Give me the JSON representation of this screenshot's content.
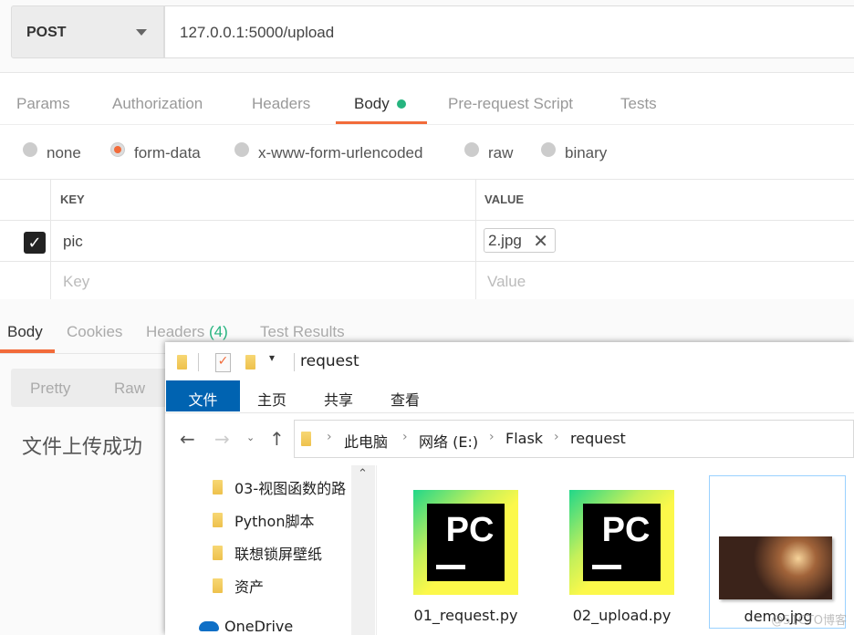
{
  "request": {
    "method": "POST",
    "url": "127.0.0.1:5000/upload"
  },
  "request_tabs": [
    {
      "label": "Params"
    },
    {
      "label": "Authorization"
    },
    {
      "label": "Headers"
    },
    {
      "label": "Body",
      "active": true
    },
    {
      "label": "Pre-request Script"
    },
    {
      "label": "Tests"
    }
  ],
  "body_types": [
    {
      "label": "none"
    },
    {
      "label": "form-data",
      "selected": true
    },
    {
      "label": "x-www-form-urlencoded"
    },
    {
      "label": "raw"
    },
    {
      "label": "binary"
    }
  ],
  "form_table": {
    "headers": [
      "KEY",
      "VALUE"
    ],
    "rows": [
      {
        "checked": true,
        "key": "pic",
        "value": "2.jpg"
      }
    ],
    "placeholders": {
      "key": "Key",
      "value": "Value"
    }
  },
  "response": {
    "tabs": [
      {
        "label": "Body",
        "active": true
      },
      {
        "label": "Cookies"
      },
      {
        "label": "Headers",
        "count": "(4)"
      },
      {
        "label": "Test Results"
      }
    ],
    "views": [
      "Pretty",
      "Raw"
    ],
    "body_text": "文件上传成功"
  },
  "explorer": {
    "title": "request",
    "ribbon_tabs": [
      "文件",
      "主页",
      "共享",
      "查看"
    ],
    "breadcrumb": [
      "此电脑",
      "网络 (E:)",
      "Flask",
      "request"
    ],
    "nav_items": [
      "03-视图函数的路",
      "Python脚本",
      "联想锁屏壁纸",
      "资产",
      "OneDrive"
    ],
    "files": [
      {
        "name": "01_request.py",
        "icon": "pycharm-icon"
      },
      {
        "name": "02_upload.py",
        "icon": "pycharm-icon"
      },
      {
        "name": "demo.jpg",
        "icon": "image-thumbnail",
        "selected": true
      }
    ]
  },
  "watermark": "@51CTO博客",
  "colors": {
    "accent": "#f26b3a",
    "green": "#26b47f",
    "ribbon_blue": "#0063b1"
  }
}
